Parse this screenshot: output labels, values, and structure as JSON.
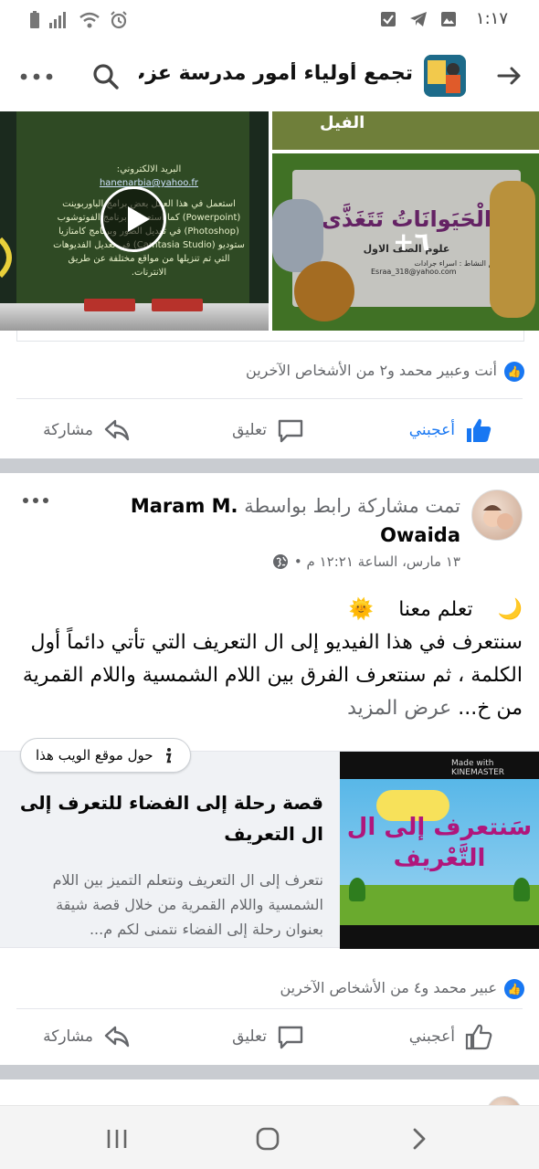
{
  "status_bar": {
    "time": "١:١٧",
    "icons": [
      "checkbox-icon",
      "telegram-icon",
      "image-icon",
      "battery-icon",
      "signal-icon",
      "wifi-icon",
      "alarm-icon"
    ]
  },
  "header": {
    "group_title": "تجمع أولياء أمور مدرسة عزب...",
    "icons": [
      "back-arrow-icon",
      "search-icon",
      "more-icon"
    ]
  },
  "post1": {
    "video_tile_text": "استعمل في هذا العمل بعض برامج الباوربوينت (Powerpoint) كما استعملت برنامج الفوتوشوب (Photoshop) في تعديل الصور وبرنامج كامتازيا ستوديو (Camtasia Studio) في تعديل الفديوهات التي تم تنزيلها من مواقع مختلفة عن طريق الانترنات.",
    "video_email": "hanenarbia@yahoo.fr",
    "video_email_label": "البريد الالكتروني:",
    "top_right_label": "الفيل",
    "animals_title": "الْحَيَوانَاتُ تَتَغَذَّى",
    "animals_subtitle": "علوم الصف الاول",
    "animals_design": "تصميم النشاط : اسراء جرادات",
    "animals_email": "Esraa_318@yahoo.com",
    "more_count": "+٦",
    "reactions_text": "أنت وعبير محمد و٢ من الأشخاص الآخرين",
    "like_label": "أعجبني",
    "comment_label": "تعليق",
    "share_label": "مشاركة"
  },
  "post2": {
    "action_text": "تمت مشاركة رابط بواسطة",
    "author": "Maram M. Owaida",
    "meta": "١٣ مارس، الساعة ١٢:٢١ م •",
    "text_line1": "تعلم معنا",
    "text_body": "سنتعرف في هذا الفيديو إلى ال التعريف التي تأتي دائماً أول الكلمة ، ثم سنتعرف الفرق بين اللام الشمسية واللام القمرية من خ...",
    "see_more": "عرض المزيد",
    "link_chip": "حول موقع الويب هذا",
    "link_title": "قصة رحلة إلى الفضاء للتعرف إلى ال التعريف",
    "link_desc": "نتعرف إلى ال التعريف ونتعلم التميز بين اللام الشمسية واللام القمرية من خلال قصة شيقة بعنوان رحلة إلى الفضاء نتمنى لكم م...",
    "thumb_title": "سَنتعرف إلى ال التَّعْريف",
    "thumb_watermark": "Made with KINEMASTER",
    "reactions_text": "عبير محمد و٤ من الأشخاص الآخرين",
    "like_label": "أعجبني",
    "comment_label": "تعليق",
    "share_label": "مشاركة"
  },
  "colors": {
    "accent": "#1877f2",
    "secondary_text": "#65676b",
    "separator": "#c9ccd1"
  }
}
